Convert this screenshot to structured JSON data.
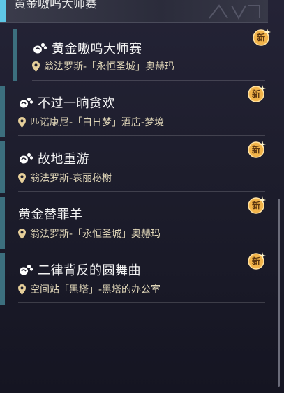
{
  "header": {
    "partial_title": "黄金嗷呜大师赛"
  },
  "quests": [
    {
      "name": "黄金嗷呜大师赛",
      "location": "翁法罗斯-「永恒圣城」奥赫玛",
      "badge": "新",
      "has_icon": true
    },
    {
      "name": "不过一晌贪欢",
      "location": "匹诺康尼-「白日梦」酒店-梦境",
      "badge": "新",
      "has_icon": true
    },
    {
      "name": "故地重游",
      "location": "翁法罗斯-哀丽秘榭",
      "badge": "新",
      "has_icon": true
    },
    {
      "name": "黄金替罪羊",
      "location": "翁法罗斯-「永恒圣城」奥赫玛",
      "badge": "新",
      "has_icon": false
    },
    {
      "name": "二律背反的圆舞曲",
      "location": "空间站「黑塔」-黑塔的办公室",
      "badge": "新",
      "has_icon": true
    }
  ],
  "icons": {
    "quest": "quest-paw-icon",
    "location": "location-pin-icon",
    "badge": "new-star-badge-icon"
  },
  "colors": {
    "accent": "#5fc7e6",
    "card_bar": "#3c6f7e",
    "badge": "#f2b44a",
    "location_text": "#e0d6b8"
  }
}
